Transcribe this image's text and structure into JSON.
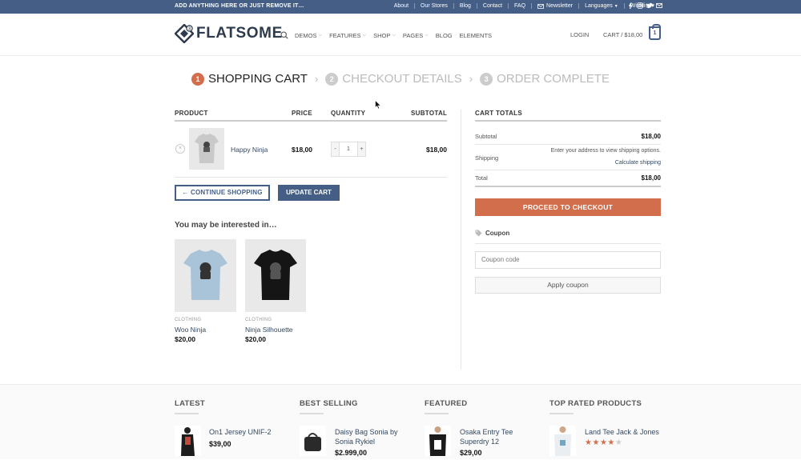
{
  "topbar": {
    "promo": "ADD ANYTHING HERE OR JUST REMOVE IT…",
    "links": [
      "About",
      "Our Stores",
      "Blog",
      "Contact",
      "FAQ",
      "Newsletter",
      "Languages",
      "Wishlist"
    ],
    "social_icons": [
      "facebook-icon",
      "instagram-icon",
      "twitter-icon",
      "email-icon"
    ]
  },
  "header": {
    "logo_text": "FLATSOME",
    "nav": [
      "DEMOS",
      "FEATURES",
      "SHOP",
      "PAGES",
      "BLOG",
      "ELEMENTS"
    ],
    "login": "LOGIN",
    "cart_label": "CART / $18,00",
    "cart_count": "1"
  },
  "steps": [
    {
      "num": "1",
      "label": "SHOPPING CART"
    },
    {
      "num": "2",
      "label": "CHECKOUT DETAILS"
    },
    {
      "num": "3",
      "label": "ORDER COMPLETE"
    }
  ],
  "cart_table": {
    "headers": {
      "product": "PRODUCT",
      "price": "PRICE",
      "quantity": "QUANTITY",
      "subtotal": "SUBTOTAL"
    },
    "row": {
      "remove": "×",
      "name": "Happy Ninja",
      "price": "$18,00",
      "qty": "1",
      "subtotal": "$18,00",
      "minus": "-",
      "plus": "+"
    },
    "continue_shopping": "← CONTINUE SHOPPING",
    "update_cart": "UPDATE CART"
  },
  "interested": {
    "title": "You may be interested in…",
    "products": [
      {
        "category": "CLOTHING",
        "name": "Woo Ninja",
        "price": "$20,00",
        "color": "#a9c3d8"
      },
      {
        "category": "CLOTHING",
        "name": "Ninja Silhouette",
        "price": "$20,00",
        "color": "#151515"
      }
    ]
  },
  "totals": {
    "title": "CART TOTALS",
    "subtotal_label": "Subtotal",
    "subtotal_value": "$18,00",
    "shipping_label": "Shipping",
    "shipping_note": "Enter your address to view shipping options.",
    "calculate_shipping": "Calculate shipping",
    "total_label": "Total",
    "total_value": "$18,00",
    "checkout": "PROCEED TO CHECKOUT",
    "coupon_title": "Coupon",
    "coupon_placeholder": "Coupon code",
    "apply_coupon": "Apply coupon"
  },
  "footer": {
    "columns": [
      {
        "title": "LATEST",
        "product": "On1 Jersey UNIF-2",
        "price": "$39,00"
      },
      {
        "title": "BEST SELLING",
        "product": "Daisy Bag Sonia by Sonia Rykiel",
        "price": "$2.999,00"
      },
      {
        "title": "FEATURED",
        "product": "Osaka Entry Tee Superdry 12",
        "price": "$29,00"
      },
      {
        "title": "TOP RATED PRODUCTS",
        "product": "Land Tee Jack & Jones",
        "rating": 4,
        "rating_max": 5
      }
    ]
  },
  "colors": {
    "primary": "#445e86",
    "accent": "#d26e4b",
    "rating": "#d26e4b"
  }
}
